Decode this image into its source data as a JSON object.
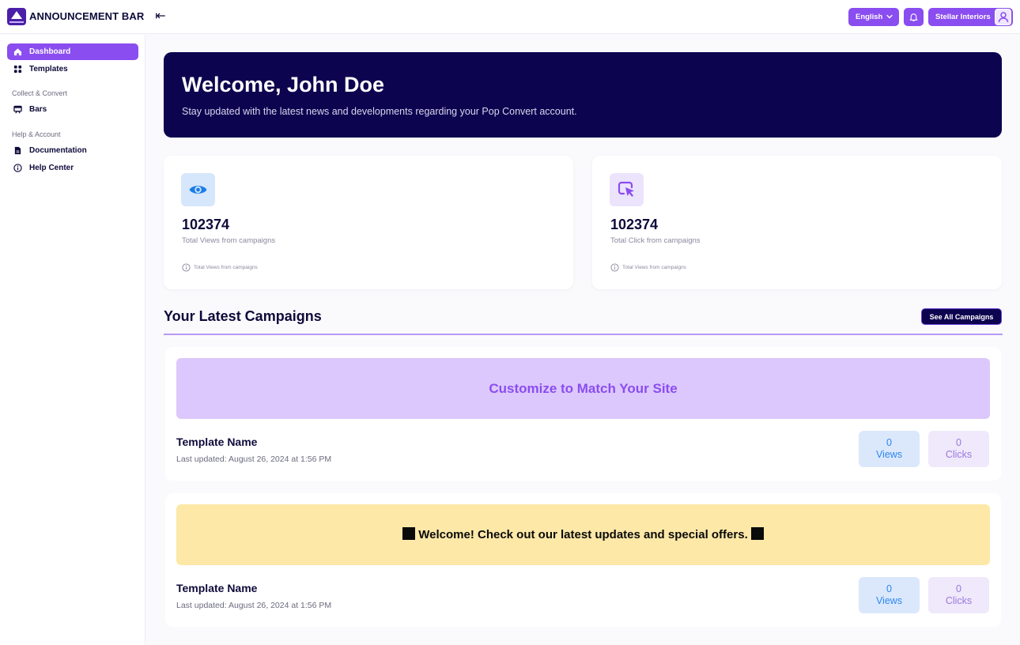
{
  "app": {
    "title": "ANNOUNCEMENT BAR",
    "brand_color": "#8a4df0",
    "dark_color": "#0c044f"
  },
  "header": {
    "language": "English",
    "account_name": "Stellar Interiors"
  },
  "sidebar": {
    "items": [
      {
        "label": "Dashboard",
        "icon": "home-icon",
        "active": true
      },
      {
        "label": "Templates",
        "icon": "grid-icon"
      }
    ],
    "sections": [
      {
        "title": "Collect & Convert",
        "items": [
          {
            "label": "Bars",
            "icon": "bar-icon"
          }
        ]
      },
      {
        "title": "Help & Account",
        "items": [
          {
            "label": "Documentation",
            "icon": "document-icon"
          },
          {
            "label": "Help Center",
            "icon": "info-icon"
          }
        ]
      }
    ]
  },
  "welcome": {
    "title": "Welcome, John Doe",
    "subtitle": "Stay updated with the latest news and developments regarding your Pop Convert account."
  },
  "stats": [
    {
      "value": "102374",
      "label": "Total Views from campaigns",
      "info": "Total Views from campaigns",
      "icon": "eye-icon"
    },
    {
      "value": "102374",
      "label": "Total Click from campaigns",
      "info": "Total Views from campaigns",
      "icon": "cursor-click-icon"
    }
  ],
  "campaigns_section": {
    "title": "Your Latest Campaigns",
    "see_all_label": "See All Campaigns"
  },
  "campaigns": [
    {
      "preview_text": "Customize to Match Your Site",
      "preview_bg": "#dcc8fc",
      "preview_color": "#8a4df0",
      "name": "Template  Name",
      "updated": "Last updated: August 26, 2024 at 1:56 PM",
      "views_count": "0",
      "views_label": "Views",
      "clicks_count": "0",
      "clicks_label": "Clicks"
    },
    {
      "preview_text": "Welcome! Check out our latest updates and special offers.",
      "preview_bg": "#fde8a8",
      "preview_color": "#0a0a0a",
      "name": "Template  Name",
      "updated": "Last updated: August 26, 2024 at 1:56 PM",
      "views_count": "0",
      "views_label": "Views",
      "clicks_count": "0",
      "clicks_label": "Clicks"
    }
  ]
}
